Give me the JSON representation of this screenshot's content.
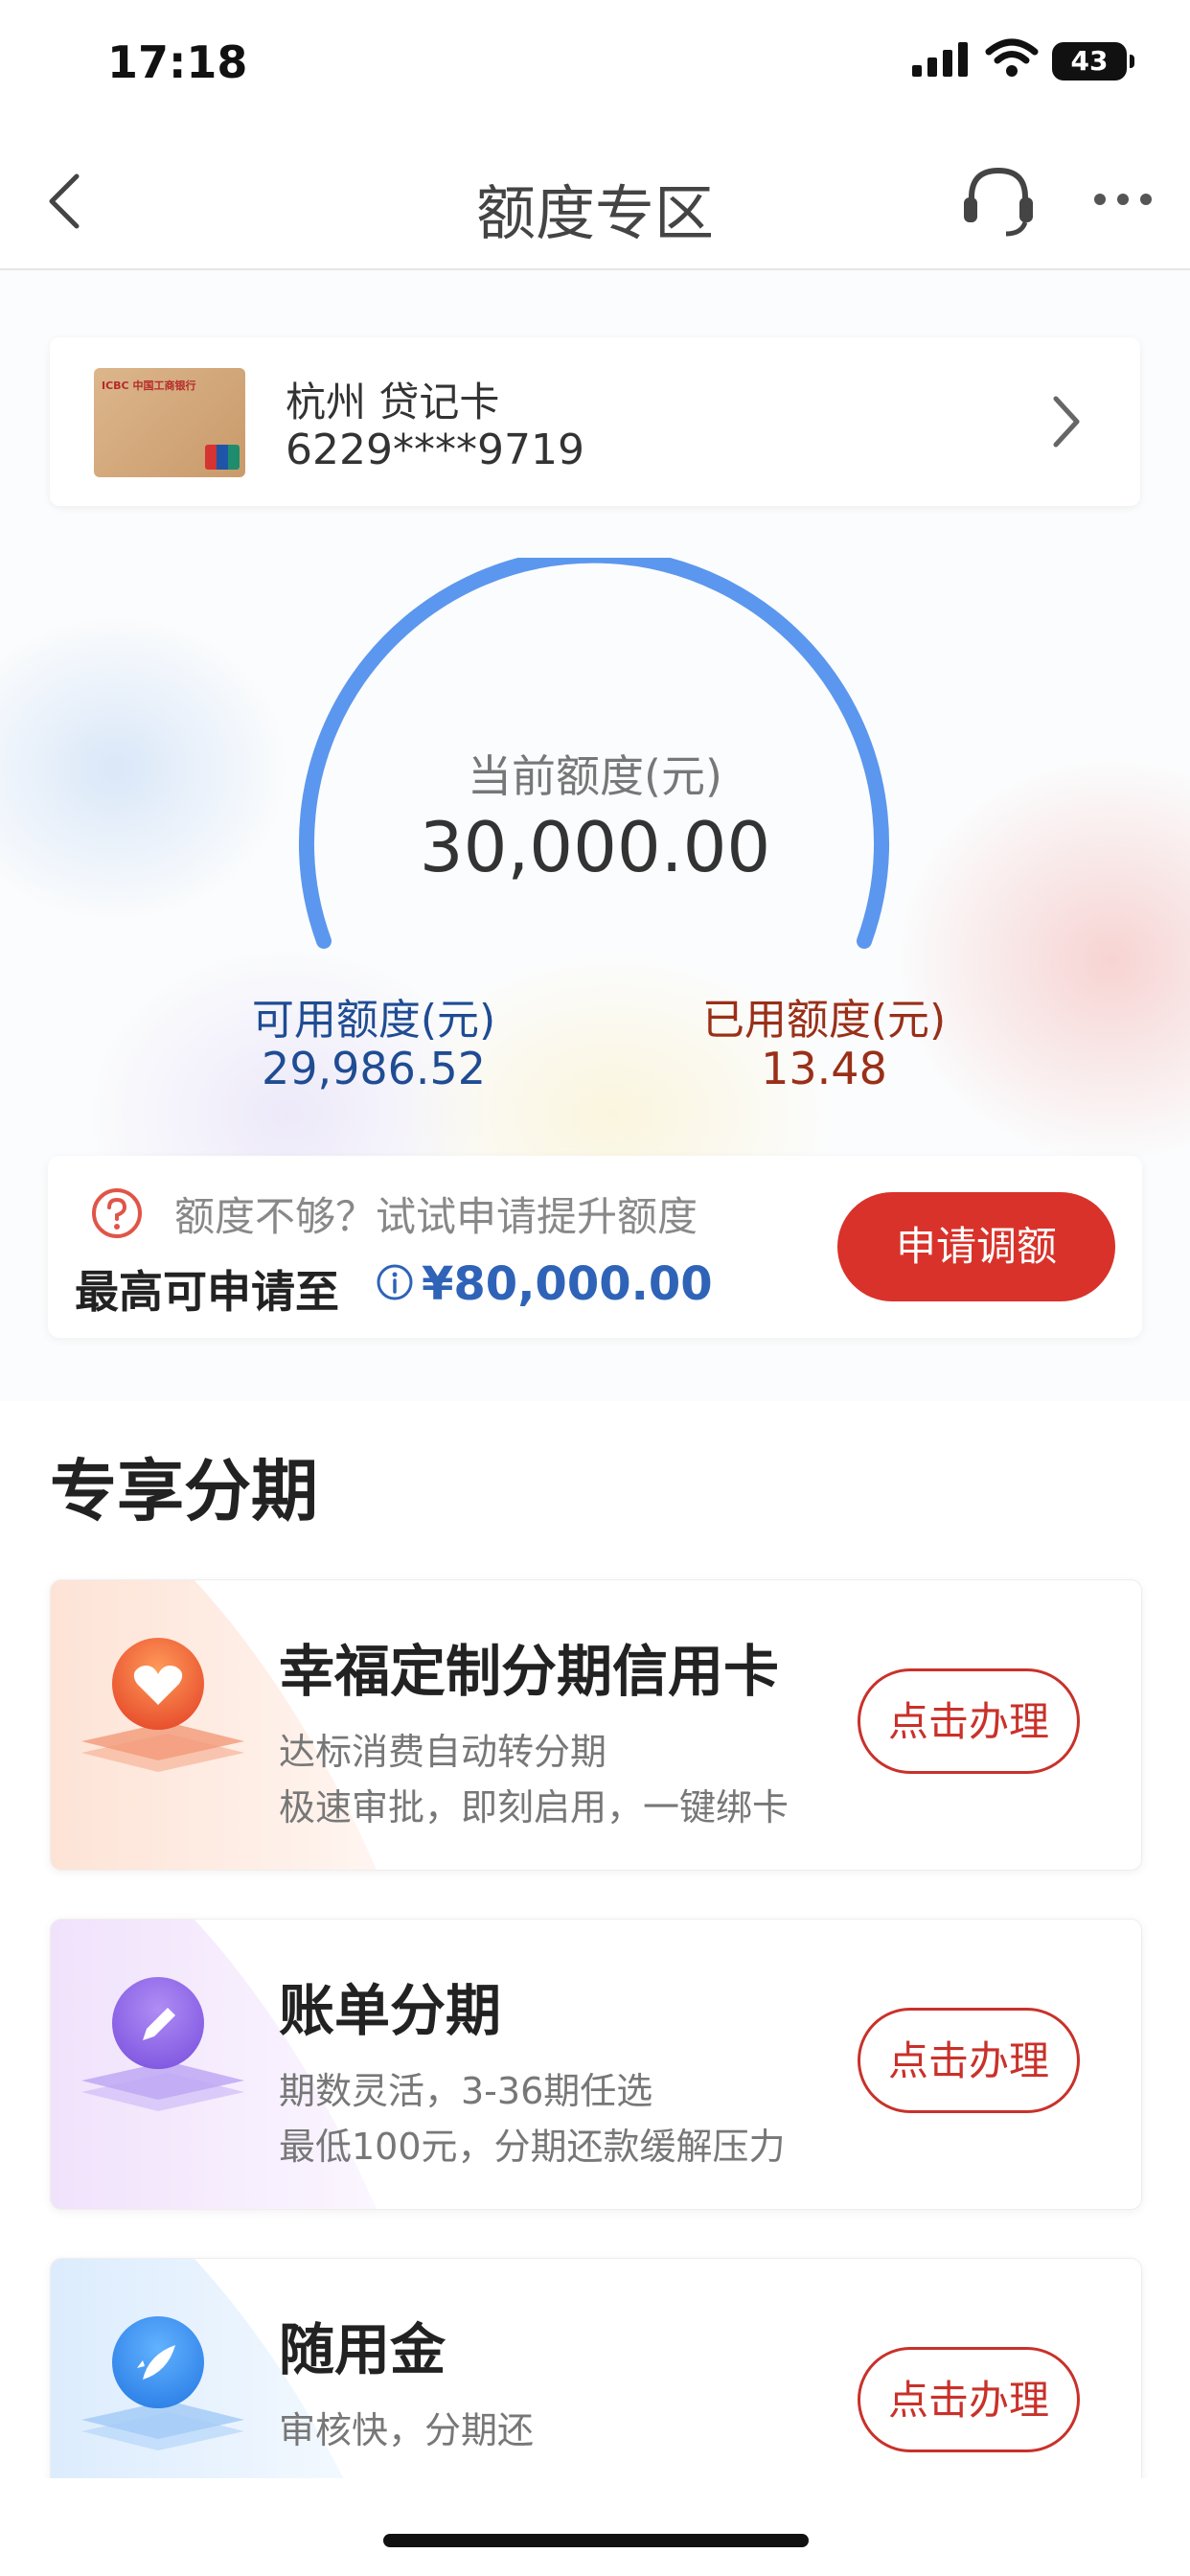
{
  "status_bar": {
    "time": "17:18",
    "battery": "43"
  },
  "nav": {
    "title": "额度专区"
  },
  "card": {
    "name": "杭州 贷记卡",
    "number": "6229****9719"
  },
  "gauge": {
    "current_label": "当前额度(元)",
    "current_value": "30,000.00",
    "available_label": "可用额度(元)",
    "available_value": "29,986.52",
    "used_label": "已用额度(元)",
    "used_value": "13.48",
    "arc_color": "#5b97ee"
  },
  "raise": {
    "tip": "额度不够？试试申请提升额度",
    "max_label": "最高可申请至",
    "max_amount": "¥80,000.00",
    "apply_label": "申请调额"
  },
  "section": {
    "title": "专享分期"
  },
  "products": [
    {
      "name": "幸福定制分期信用卡",
      "desc1": "达标消费自动转分期",
      "desc2": "极速审批，即刻启用，一键绑卡",
      "button": "点击办理",
      "icon": "heart-icon"
    },
    {
      "name": "账单分期",
      "desc1": "期数灵活，3-36期任选",
      "desc2": "最低100元，分期还款缓解压力",
      "button": "点击办理",
      "icon": "pencil-icon"
    },
    {
      "name": "随用金",
      "desc1": "审核快，分期还",
      "button": "点击办理",
      "icon": "rocket-icon"
    }
  ],
  "colors": {
    "brand_red": "#d9322a",
    "link_blue": "#2f63b8"
  }
}
